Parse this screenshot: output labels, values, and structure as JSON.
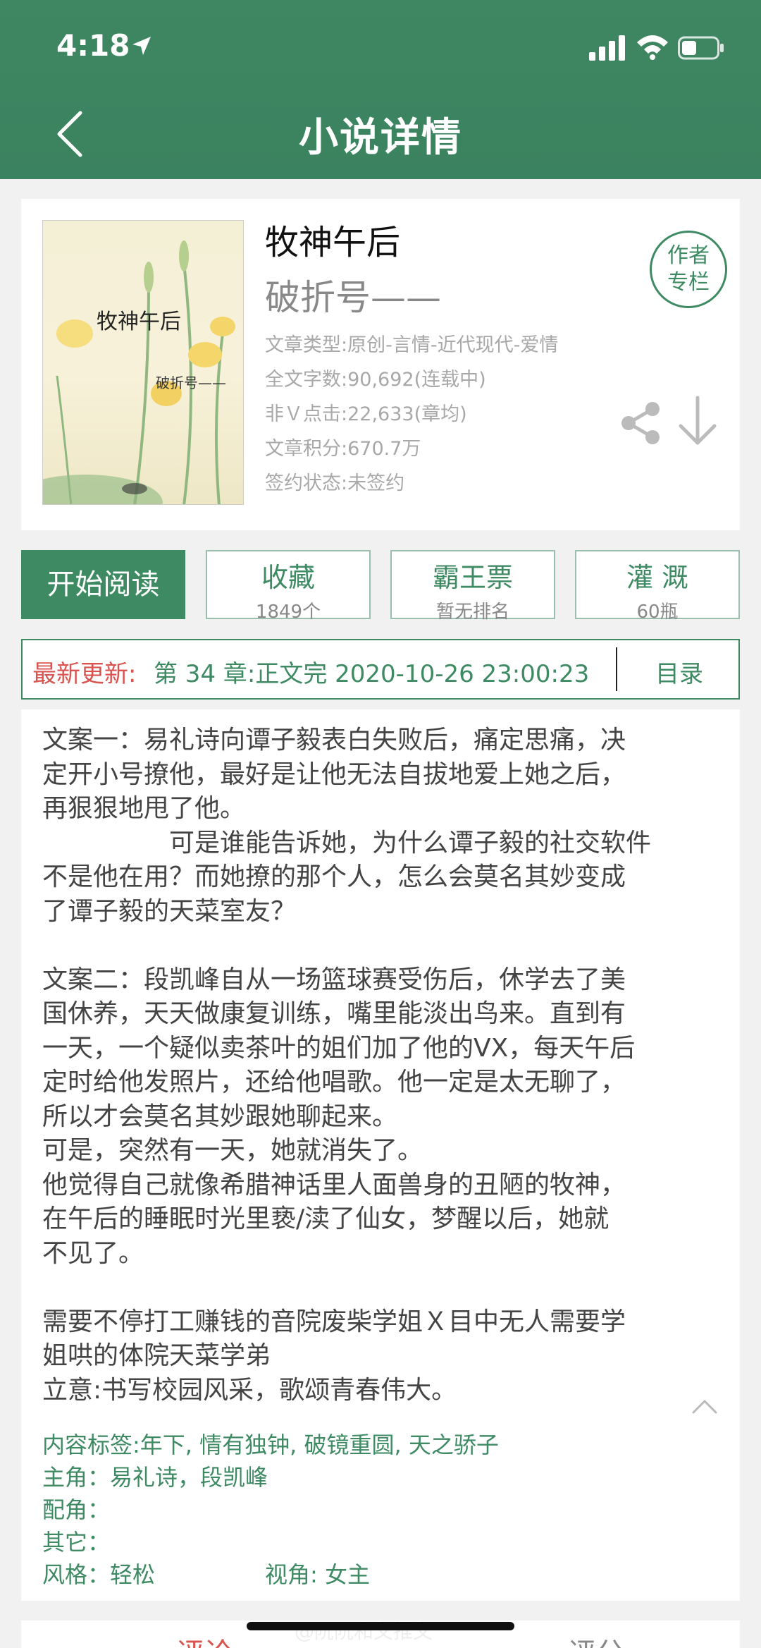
{
  "status_bar": {
    "time": "4:18"
  },
  "header": {
    "title": "小说详情"
  },
  "book": {
    "title": "牧神午后",
    "author": "破折号——",
    "cover_title": "牧神午后",
    "cover_author": "破折号——",
    "meta": [
      "文章类型:原创-言情-近代现代-爱情",
      "全文字数:90,692(连载中)",
      "非Ｖ点击:22,633(章均)",
      "文章积分:670.7万",
      "签约状态:未签约"
    ],
    "author_column_line1": "作者",
    "author_column_line2": "专栏"
  },
  "actions": {
    "read_label": "开始阅读",
    "favorite_label": "收藏",
    "favorite_sub": "1849个",
    "ticket_label": "霸王票",
    "ticket_sub": "暂无排名",
    "water_label": "灌 溉",
    "water_sub": "60瓶"
  },
  "update": {
    "label": "最新更新:",
    "text": "第 34 章:正文完 2020-10-26 23:00:23",
    "catalog_label": "目录"
  },
  "synopsis": {
    "lines": [
      "文案一：易礼诗向谭子毅表白失败后，痛定思痛，决",
      "定开小号撩他，最好是让他无法自拔地爱上她之后，",
      "再狠狠地甩了他。",
      "　　　　　可是谁能告诉她，为什么谭子毅的社交软件",
      "不是他在用？而她撩的那个人，怎么会莫名其妙变成",
      "了谭子毅的天菜室友？",
      "",
      "文案二：段凯峰自从一场篮球赛受伤后，休学去了美",
      "国休养，天天做康复训练，嘴里能淡出鸟来。直到有",
      "一天，一个疑似卖茶叶的姐们加了他的VX，每天午后",
      "定时给他发照片，还给他唱歌。他一定是太无聊了，",
      "所以才会莫名其妙跟她聊起来。",
      "可是，突然有一天，她就消失了。",
      "他觉得自己就像希腊神话里人面兽身的丑陋的牧神，",
      "在午后的睡眠时光里亵/渎了仙女，梦醒以后，她就",
      "不见了。",
      "",
      "需要不停打工赚钱的音院废柴学姐Ｘ目中无人需要学",
      "姐哄的体院天菜学弟",
      "立意:书写校园风采，歌颂青春伟大。"
    ],
    "tags": "内容标签:年下, 情有独钟, 破镜重圆, 天之骄子",
    "protagonists": "主角：易礼诗，段凯峰",
    "supporting": "配角：",
    "others": "其它：",
    "style": "风格：轻松",
    "perspective": "视角: 女主"
  },
  "tabs": {
    "comment": "评论",
    "rating": "评分"
  },
  "watermark": "@阮阮和文推文",
  "colors": {
    "brand_green": "#3e8a63",
    "accent_red": "#d9534f"
  }
}
